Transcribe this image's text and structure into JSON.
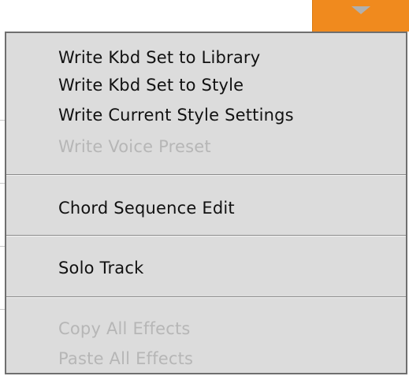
{
  "trigger": {
    "icon": "chevron-down-icon",
    "color": "#f08a1e"
  },
  "menu": {
    "group1": [
      {
        "label": "Write Kbd Set to Library",
        "enabled": true
      },
      {
        "label": "Write Kbd Set to Style",
        "enabled": true
      },
      {
        "label": "Write Current Style Settings",
        "enabled": true
      },
      {
        "label": "Write Voice Preset",
        "enabled": false
      }
    ],
    "group2": [
      {
        "label": "Chord Sequence Edit",
        "enabled": true
      }
    ],
    "group3": [
      {
        "label": "Solo Track",
        "enabled": true
      }
    ],
    "group4": [
      {
        "label": "Copy All Effects",
        "enabled": false
      },
      {
        "label": "Paste All Effects",
        "enabled": false
      }
    ]
  }
}
